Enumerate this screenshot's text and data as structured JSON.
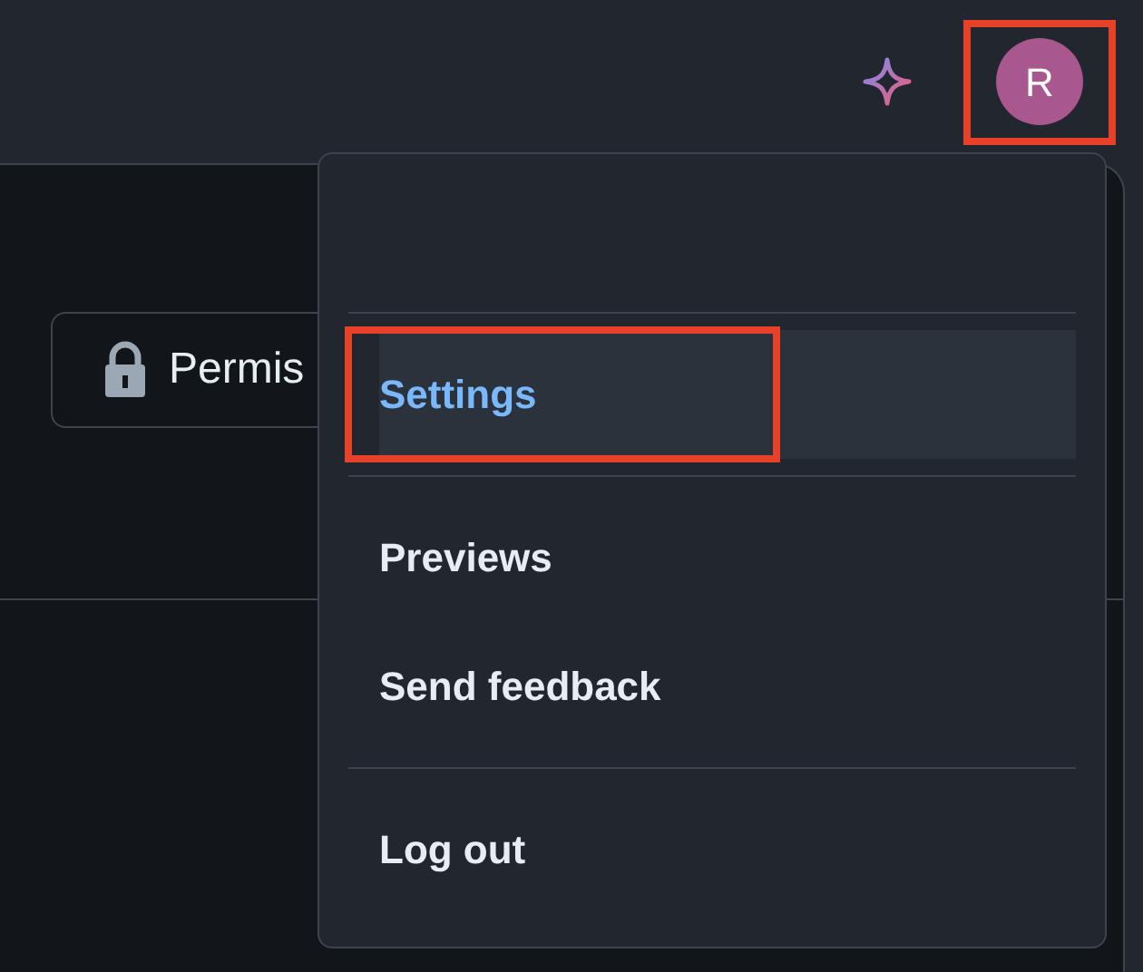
{
  "header": {
    "avatar": {
      "initial": "R",
      "highlighted": true
    }
  },
  "permission_button": {
    "label": "Permis"
  },
  "menu": {
    "items": [
      {
        "label": "Settings",
        "selected": true,
        "highlighted": true,
        "divider_before": true
      },
      {
        "label": "Previews",
        "selected": false,
        "highlighted": false,
        "divider_before": true
      },
      {
        "label": "Send feedback",
        "selected": false,
        "highlighted": false,
        "divider_before": false
      },
      {
        "label": "Log out",
        "selected": false,
        "highlighted": false,
        "divider_before": true
      }
    ]
  }
}
